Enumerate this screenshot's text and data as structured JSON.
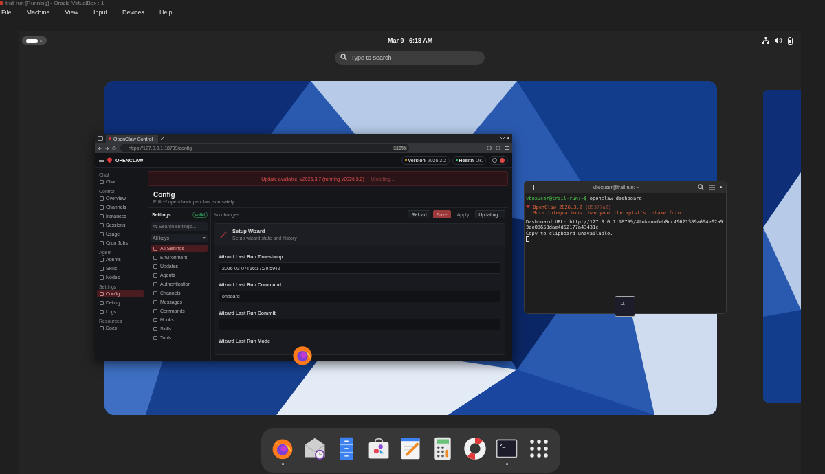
{
  "vbox": {
    "title": "trail run [Running] - Oracle VirtualBox : 1",
    "menu": [
      "File",
      "Machine",
      "View",
      "Input",
      "Devices",
      "Help"
    ]
  },
  "topbar": {
    "date": "Mar 9",
    "time": "6:18 AM"
  },
  "search": {
    "placeholder": "Type to search"
  },
  "browser": {
    "tab": "OpenClaw Control",
    "url": "https://127.0.0.1:18789/config",
    "zoom": "110%",
    "app": {
      "brand": "OPENCLAW",
      "version_label": "Version",
      "version": "2026.3.2",
      "health_label": "Health",
      "health": "OK",
      "banner": "Update available: v2026.3.7 (running v2026.3.2)",
      "banner_status": "Updating...",
      "nav": [
        {
          "group": "Chat",
          "items": [
            {
              "label": "Chat",
              "selected": false
            }
          ]
        },
        {
          "group": "Control",
          "items": [
            {
              "label": "Overview",
              "selected": false
            },
            {
              "label": "Channels",
              "selected": false
            },
            {
              "label": "Instances",
              "selected": false
            },
            {
              "label": "Sessions",
              "selected": false
            },
            {
              "label": "Usage",
              "selected": false
            },
            {
              "label": "Cron Jobs",
              "selected": false
            }
          ]
        },
        {
          "group": "Agent",
          "items": [
            {
              "label": "Agents",
              "selected": false
            },
            {
              "label": "Skills",
              "selected": false
            },
            {
              "label": "Nodes",
              "selected": false
            }
          ]
        },
        {
          "group": "Settings",
          "items": [
            {
              "label": "Config",
              "selected": true
            },
            {
              "label": "Debug",
              "selected": false
            },
            {
              "label": "Logs",
              "selected": false
            }
          ]
        },
        {
          "group": "Resources",
          "items": [
            {
              "label": "Docs",
              "selected": false
            }
          ]
        }
      ],
      "page": {
        "title": "Config",
        "subtitle": "Edit ~/.openclaw/openclaw.json safely"
      },
      "settings": {
        "title": "Settings",
        "badge": "valid",
        "status": "No changes",
        "actions": [
          {
            "label": "Reload",
            "kind": "default"
          },
          {
            "label": "Save",
            "kind": "primary"
          },
          {
            "label": "Apply",
            "kind": "plain"
          },
          {
            "label": "Updating...",
            "kind": "default"
          }
        ],
        "search_placeholder": "Search settings...",
        "filter": "All keys",
        "sections": [
          {
            "label": "All Settings",
            "selected": true
          },
          {
            "label": "Environment",
            "selected": false
          },
          {
            "label": "Updates",
            "selected": false
          },
          {
            "label": "Agents",
            "selected": false
          },
          {
            "label": "Authentication",
            "selected": false
          },
          {
            "label": "Channels",
            "selected": false
          },
          {
            "label": "Messages",
            "selected": false
          },
          {
            "label": "Commands",
            "selected": false
          },
          {
            "label": "Hooks",
            "selected": false
          },
          {
            "label": "Skills",
            "selected": false
          },
          {
            "label": "Tools",
            "selected": false
          }
        ],
        "card": {
          "title": "Setup Wizard",
          "subtitle": "Setup wizard state and history",
          "fields": [
            {
              "label": "Wizard Last Run Timestamp",
              "value": "2026-03-07T16:17:29.594Z"
            },
            {
              "label": "Wizard Last Run Command",
              "value": "onboard"
            },
            {
              "label": "Wizard Last Run Commit"
            },
            {
              "label": "Wizard Last Run Mode"
            }
          ]
        }
      }
    }
  },
  "terminal": {
    "title": "vboxuser@trail-run: ~",
    "prompt": "vboxuser@trail-run:~$",
    "command": "openclaw dashboard",
    "banner": "OpenClaw 2026.3.2",
    "commit": "(85377a2)",
    "tagline": "More integrations than your therapist's intake form.",
    "lines": [
      "Dashboard URL: http://127.0.0.1:18789/#token=feb0cc49621389a694e62a93ae08653dae4d52177a43431c",
      "Copy to clipboard unavailable."
    ]
  },
  "dock": [
    {
      "kind": "firefox",
      "running": true
    },
    {
      "kind": "mail",
      "running": false
    },
    {
      "kind": "files",
      "running": false
    },
    {
      "kind": "store",
      "running": false
    },
    {
      "kind": "editor",
      "running": false
    },
    {
      "kind": "calculator",
      "running": false
    },
    {
      "kind": "help",
      "running": false
    },
    {
      "kind": "terminal",
      "running": true
    },
    {
      "kind": "apps",
      "running": false
    }
  ]
}
